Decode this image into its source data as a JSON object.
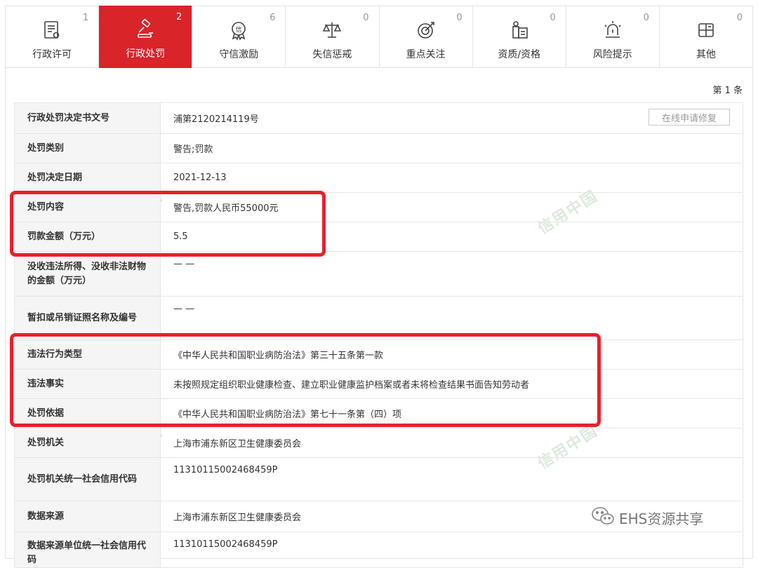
{
  "tabs": [
    {
      "label": "行政许可",
      "count": "1",
      "icon": "document-icon"
    },
    {
      "label": "行政处罚",
      "count": "2",
      "icon": "gavel-icon",
      "active": true
    },
    {
      "label": "守信激励",
      "count": "6",
      "icon": "badge-icon"
    },
    {
      "label": "失信惩戒",
      "count": "0",
      "icon": "scale-icon"
    },
    {
      "label": "重点关注",
      "count": "0",
      "icon": "target-icon"
    },
    {
      "label": "资质/资格",
      "count": "0",
      "icon": "certificate-icon"
    },
    {
      "label": "风险提示",
      "count": "0",
      "icon": "alarm-icon"
    },
    {
      "label": "其他",
      "count": "0",
      "icon": "grid-icon"
    }
  ],
  "record_count": "第 1 条",
  "fix_button": "在线申请修复",
  "rows": [
    {
      "key": "行政处罚决定书文号",
      "value": "浦第2120214119号"
    },
    {
      "key": "处罚类别",
      "value": "警告;罚款"
    },
    {
      "key": "处罚决定日期",
      "value": "2021-12-13"
    },
    {
      "key": "处罚内容",
      "value": "警告,罚款人民币55000元"
    },
    {
      "key": "罚款金额（万元）",
      "value": "5.5"
    },
    {
      "key": "没收违法所得、没收非法财物的金额（万元）",
      "value": "— —"
    },
    {
      "key": "暂扣或吊销证照名称及编号",
      "value": "— —"
    },
    {
      "key": "违法行为类型",
      "value": "《中华人民共和国职业病防治法》第三十五条第一款"
    },
    {
      "key": "违法事实",
      "value": "未按照规定组织职业健康检查、建立职业健康监护档案或者未将检查结果书面告知劳动者"
    },
    {
      "key": "处罚依据",
      "value": "《中华人民共和国职业病防治法》第七十一条第（四）项"
    },
    {
      "key": "处罚机关",
      "value": "上海市浦东新区卫生健康委员会"
    },
    {
      "key": "处罚机关统一社会信用代码",
      "value": "11310115002468459P"
    },
    {
      "key": "数据来源",
      "value": "上海市浦东新区卫生健康委员会"
    },
    {
      "key": "数据来源单位统一社会信用代码",
      "value": "11310115002468459P"
    }
  ],
  "watermark_text": "信用中国",
  "source_label": "EHS资源共享",
  "colors": {
    "accent": "#d9242a",
    "highlight": "#e8202c"
  }
}
